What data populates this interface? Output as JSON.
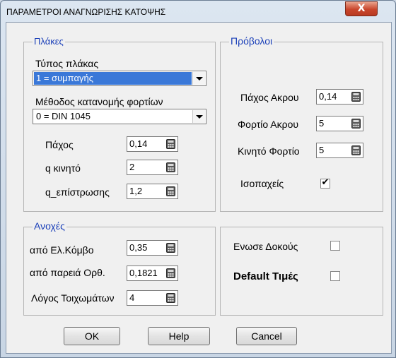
{
  "window": {
    "title": "ΠΑΡΑΜΕΤΡΟΙ ΑΝΑΓΝΩΡΙΣΗΣ ΚΑΤΟΨΗΣ",
    "close_symbol": "X"
  },
  "plakes": {
    "title": "Πλάκες",
    "slab_type_label": "Τύπος πλάκας",
    "slab_type_value": "1 = συμπαγής",
    "load_method_label": "Μέθοδος κατανομής φορτίων",
    "load_method_value": "0 = DIN 1045",
    "thickness_label": "Πάχος",
    "thickness_value": "0,14",
    "live_label": "q κινητό",
    "live_value": "2",
    "coating_label": "q_επίστρωσης",
    "coating_value": "1,2"
  },
  "provoloi": {
    "title": "Πρόβολοι",
    "tip_thickness_label": "Πάχος Ακρου",
    "tip_thickness_value": "0,14",
    "tip_load_label": "Φορτίο Ακρου",
    "tip_load_value": "5",
    "live_load_label": "Κινητό Φορτίο",
    "live_load_value": "5",
    "uniform_label": "Ισοπαχείς",
    "uniform_checked": true
  },
  "anoxes": {
    "title": "Ανοχές",
    "node_label": "από Ελ.Κόμβο",
    "node_value": "0,35",
    "wall_label": "από παρειά Ορθ.",
    "wall_value": "0,1821",
    "ratio_label": "Λόγος Τοιχωμάτων",
    "ratio_value": "4"
  },
  "options": {
    "join_beams_label": "Ενωσε Δοκούς",
    "join_beams_checked": false,
    "defaults_label": "Default Τιμές",
    "defaults_checked": false
  },
  "buttons": {
    "ok": "OK",
    "help": "Help",
    "cancel": "Cancel"
  }
}
